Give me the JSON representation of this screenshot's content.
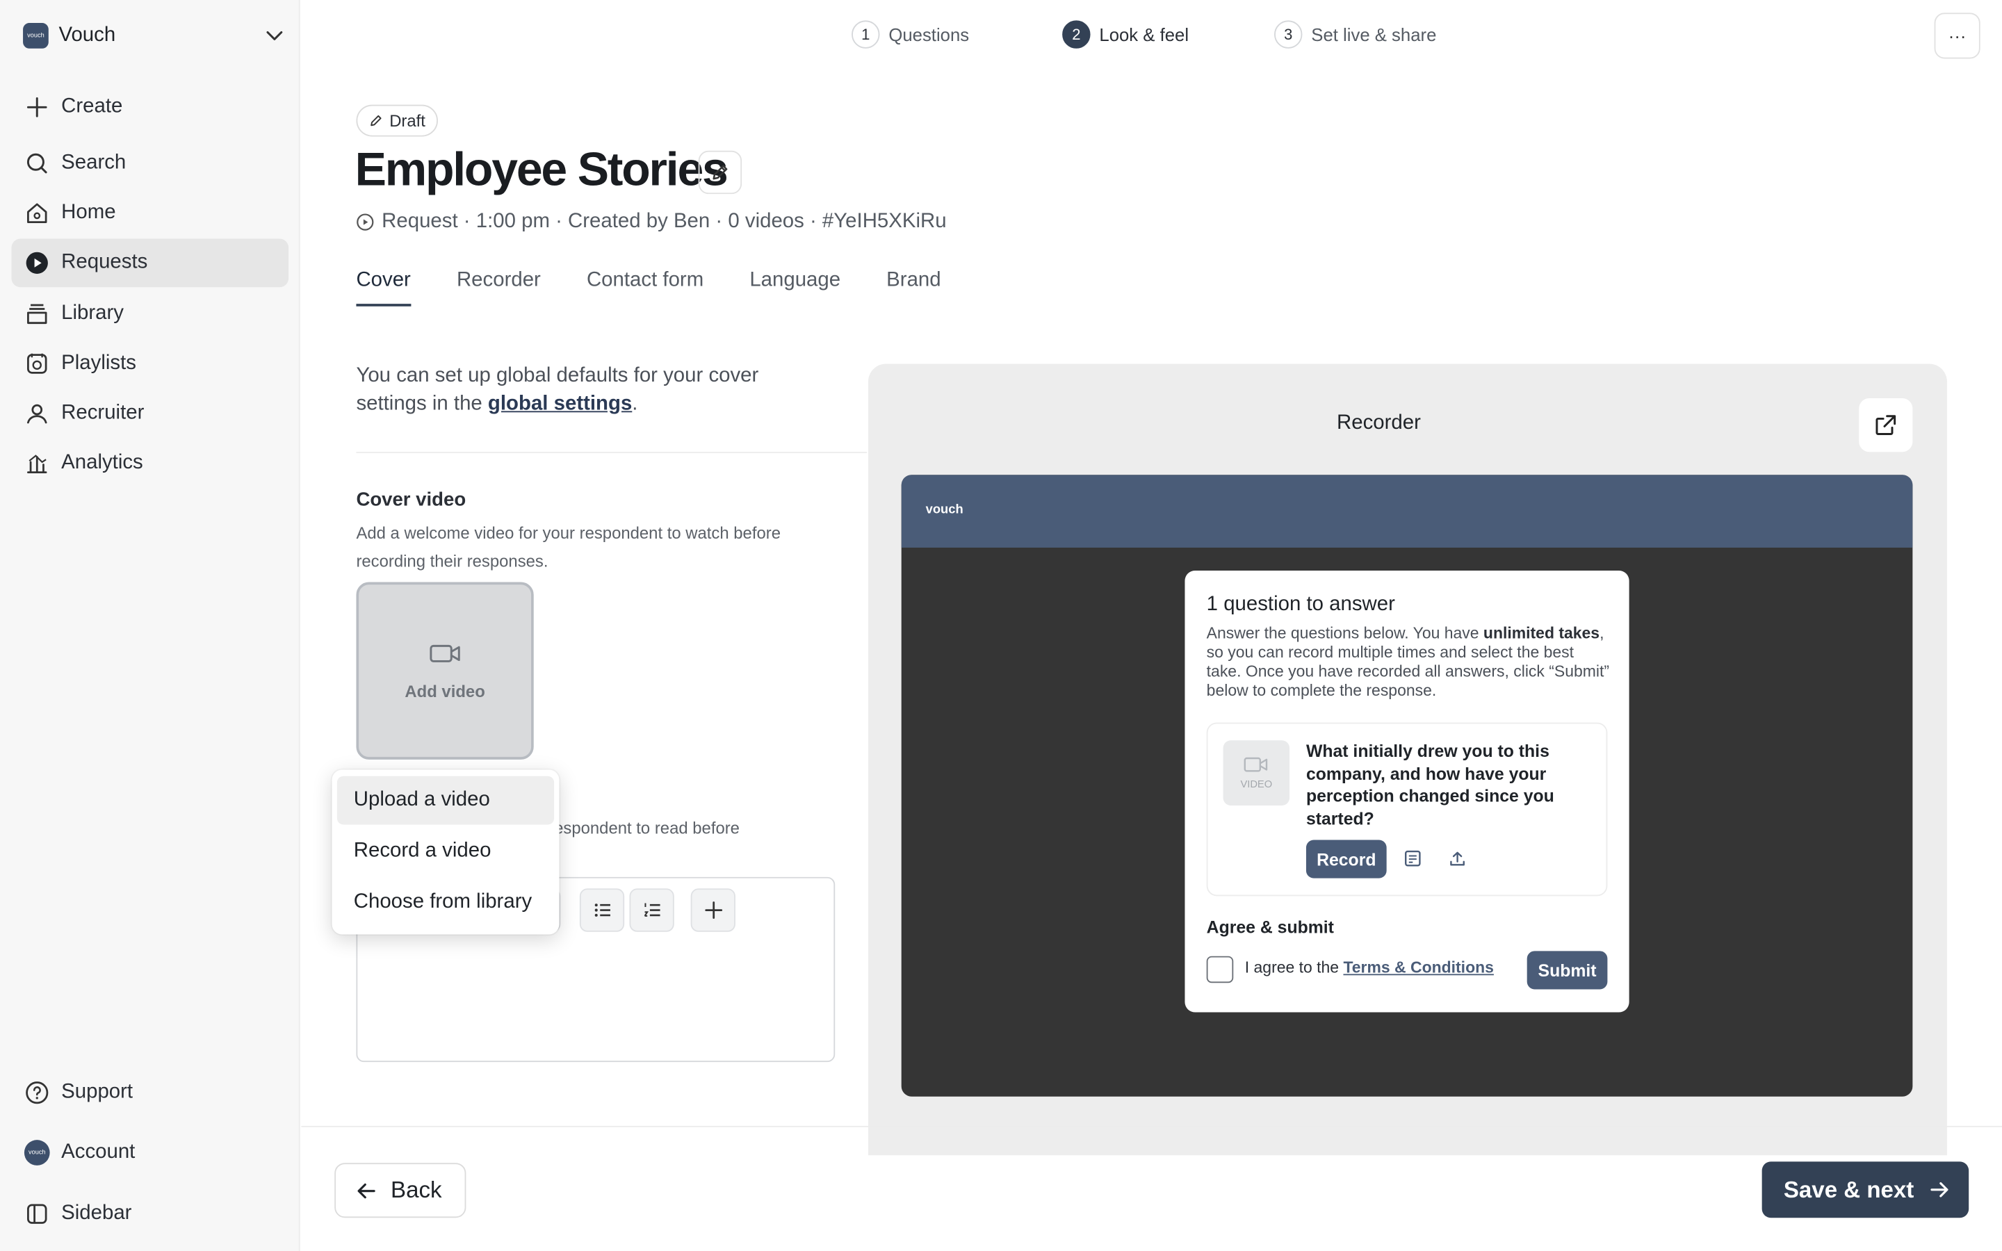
{
  "workspace": {
    "name": "Vouch",
    "logo_text": "vouch"
  },
  "sidebar": {
    "items": [
      {
        "label": "Create",
        "icon": "plus-icon"
      },
      {
        "label": "Search",
        "icon": "search-icon"
      },
      {
        "label": "Home",
        "icon": "home-icon"
      },
      {
        "label": "Requests",
        "icon": "play-circle-icon",
        "active": true
      },
      {
        "label": "Library",
        "icon": "library-icon"
      },
      {
        "label": "Playlists",
        "icon": "playlist-icon"
      },
      {
        "label": "Recruiter",
        "icon": "user-icon"
      },
      {
        "label": "Analytics",
        "icon": "analytics-icon"
      }
    ],
    "bottom": [
      {
        "label": "Support",
        "icon": "help-icon"
      },
      {
        "label": "Account",
        "icon": "avatar"
      },
      {
        "label": "Sidebar",
        "icon": "sidebar-icon"
      }
    ]
  },
  "stepper": {
    "steps": [
      {
        "num": "1",
        "label": "Questions"
      },
      {
        "num": "2",
        "label": "Look & feel",
        "active": true
      },
      {
        "num": "3",
        "label": "Set live & share"
      }
    ],
    "more_label": "···"
  },
  "header": {
    "status": "Draft",
    "title": "Employee Stories",
    "meta": "Request · 1:00 pm · Created by Ben · 0 videos · #YeIH5XKiRu"
  },
  "tabs": [
    "Cover",
    "Recorder",
    "Contact form",
    "Language",
    "Brand"
  ],
  "cover": {
    "intro_prefix": "You can set up global defaults for your cover settings in the ",
    "intro_link": "global settings",
    "intro_suffix": ".",
    "video_title": "Cover video",
    "video_desc": "Add a welcome video for your respondent to watch before recording their responses.",
    "add_video_label": "Add video",
    "text_desc_visible": "espondent to read before",
    "text_desc_line2": "."
  },
  "dropdown": {
    "items": [
      "Upload a video",
      "Record a video",
      "Choose from library"
    ]
  },
  "preview": {
    "title": "Recorder",
    "brand": "vouch",
    "card_title": "1 question to answer",
    "desc_a": "Answer the questions below. You have ",
    "desc_bold": "unlimited takes",
    "desc_b": ", so you can record multiple times and select the best take. Once you have recorded all answers, click “Submit” below to complete the response.",
    "video_placeholder": "VIDEO",
    "question": "What initially drew you to this company, and how have your perception changed since you started?",
    "record_label": "Record",
    "agree_title": "Agree & submit",
    "agree_prefix": "I agree to the ",
    "agree_link": "Terms & Conditions",
    "submit_label": "Submit"
  },
  "footer": {
    "back_label": "Back",
    "save_label": "Save & next"
  },
  "colors": {
    "accent": "#334155",
    "brand_bar": "#4a5c78",
    "frame_bg": "#353535"
  }
}
